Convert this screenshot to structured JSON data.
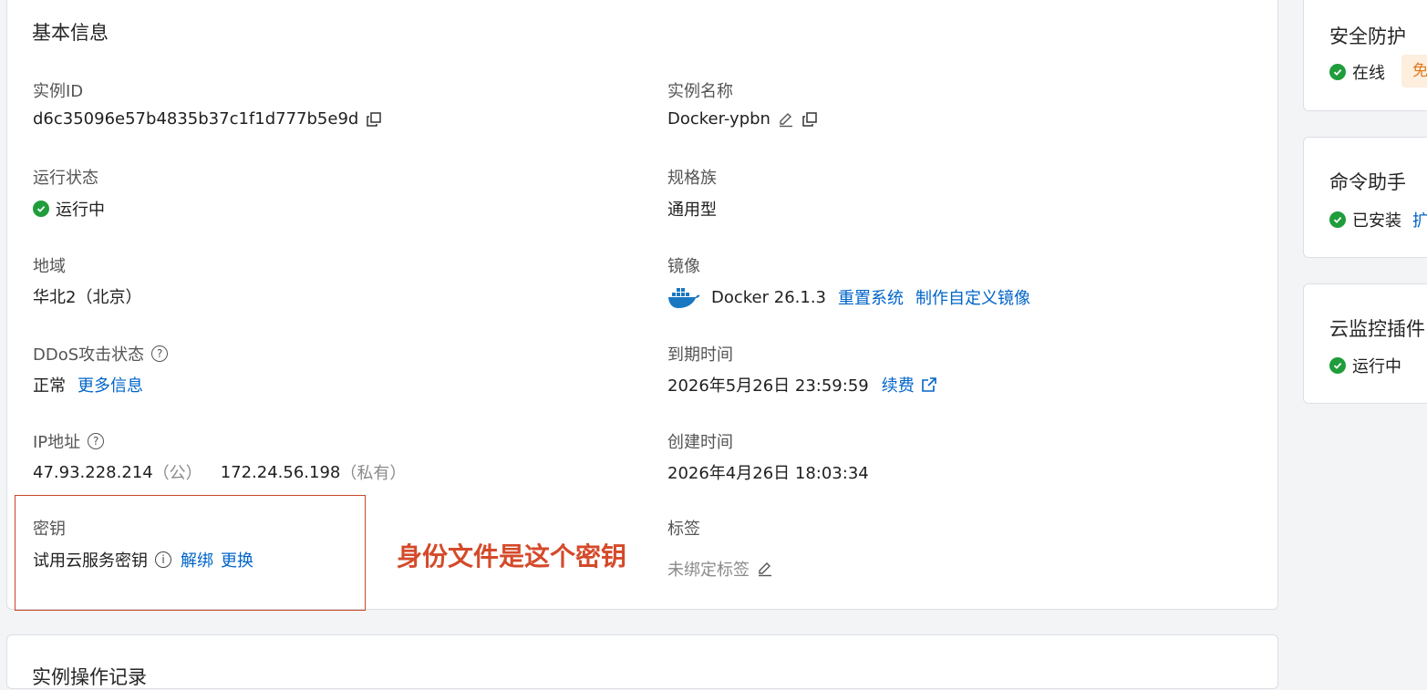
{
  "basic_info": {
    "title": "基本信息",
    "instance_id": {
      "label": "实例ID",
      "value": "d6c35096e57b4835b37c1f1d777b5e9d"
    },
    "instance_name": {
      "label": "实例名称",
      "value": "Docker-ypbn"
    },
    "run_status": {
      "label": "运行状态",
      "value": "运行中"
    },
    "spec_family": {
      "label": "规格族",
      "value": "通用型"
    },
    "region": {
      "label": "地域",
      "value": "华北2（北京）"
    },
    "image": {
      "label": "镜像",
      "value": "Docker 26.1.3",
      "reset_link": "重置系统",
      "custom_image_link": "制作自定义镜像"
    },
    "ddos": {
      "label": "DDoS攻击状态",
      "value": "正常",
      "more_link": "更多信息"
    },
    "expire_time": {
      "label": "到期时间",
      "value": "2026年5月26日 23:59:59",
      "renew_link": "续费"
    },
    "ip": {
      "label": "IP地址",
      "public_ip": "47.93.228.214",
      "public_suffix": "（公）",
      "private_ip": "172.24.56.198",
      "private_suffix": "（私有）"
    },
    "create_time": {
      "label": "创建时间",
      "value": "2026年4月26日 18:03:34"
    },
    "key": {
      "label": "密钥",
      "value": "试用云服务密钥",
      "unbind_link": "解绑",
      "replace_link": "更换"
    },
    "tags": {
      "label": "标签",
      "value": "未绑定标签"
    }
  },
  "annotation": {
    "text": "身份文件是这个密钥",
    "color": "#d44a2a"
  },
  "side": {
    "security": {
      "title": "安全防护",
      "status": "在线",
      "badge": "免"
    },
    "command": {
      "title": "命令助手",
      "status": "已安装",
      "link": "扩"
    },
    "monitor": {
      "title": "云监控插件",
      "status": "运行中"
    }
  },
  "lower_card": {
    "title": "实例操作记录"
  },
  "colors": {
    "link": "#0064c8",
    "success": "#1f9d3b",
    "annotation": "#c8452a"
  },
  "icons": [
    "copy-icon",
    "edit-icon",
    "check-circle-icon",
    "help-icon",
    "info-icon",
    "docker-icon",
    "external-link-icon"
  ]
}
